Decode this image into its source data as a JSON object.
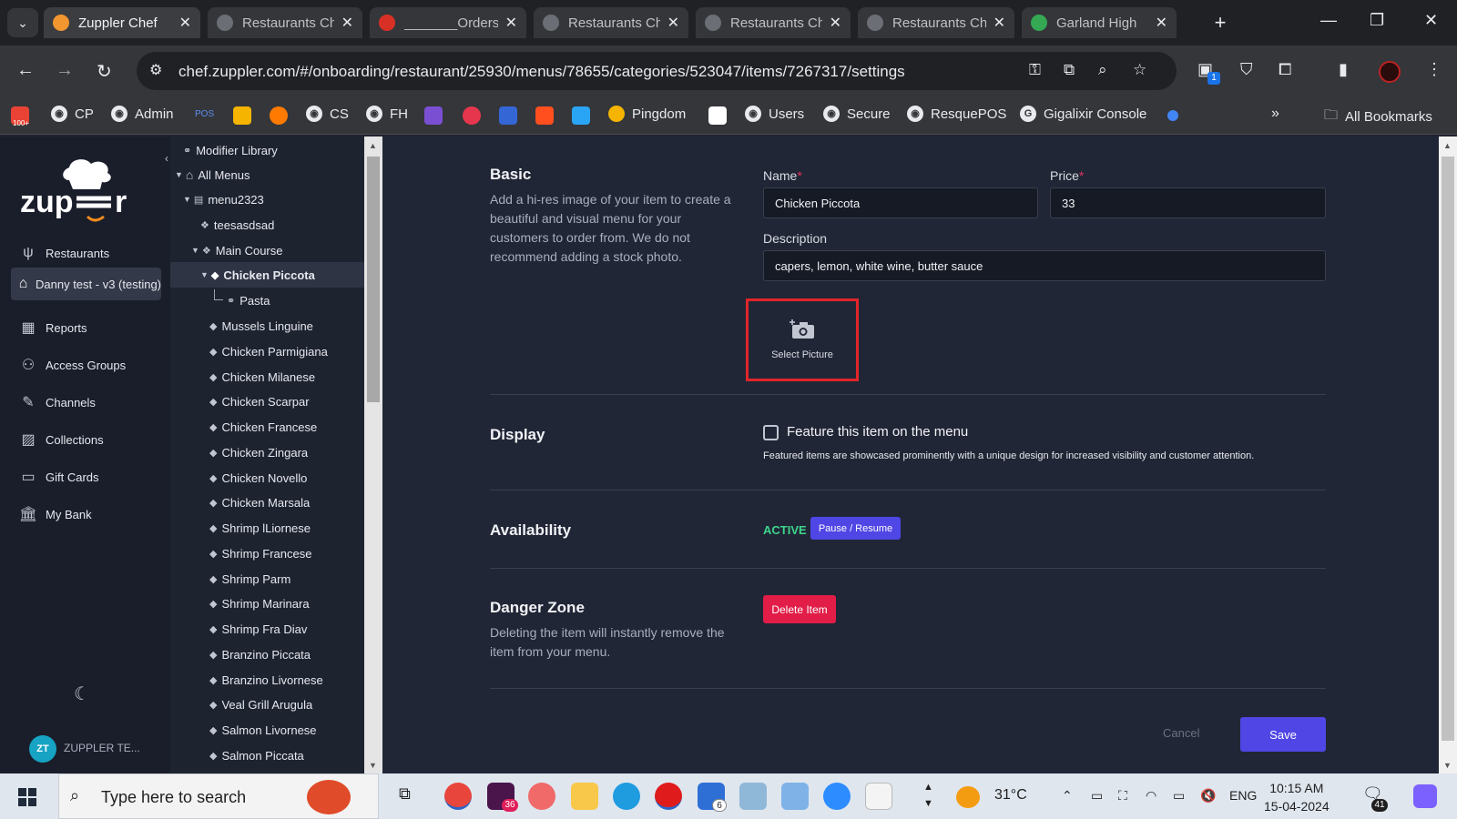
{
  "browser": {
    "tabs": [
      {
        "title": "Zuppler Chef",
        "active": true
      },
      {
        "title": "Restaurants Chef",
        "active": false
      },
      {
        "title": "_______Orders",
        "active": false
      },
      {
        "title": "Restaurants Chef",
        "active": false
      },
      {
        "title": "Restaurants Chef",
        "active": false
      },
      {
        "title": "Restaurants Chef",
        "active": false
      },
      {
        "title": "Garland High",
        "active": false
      }
    ],
    "url": "chef.zuppler.com/#/onboarding/restaurant/25930/menus/78655/categories/523047/items/7267317/settings",
    "extension_badge": "1",
    "bookmarks": [
      "CP",
      "Admin",
      "POS",
      "CS",
      "FH",
      "Pingdom",
      "Users",
      "Secure",
      "ResquePOS",
      "Gigalixir Console"
    ],
    "gmail_badge": "100+",
    "all_bookmarks": "All Bookmarks"
  },
  "sidebar": {
    "brand": "zupper",
    "items": [
      {
        "label": "Restaurants",
        "icon": "utensils-icon"
      },
      {
        "label": "Danny test - v3 (testing)",
        "icon": "home-icon",
        "selected": true
      },
      {
        "label": "Reports",
        "icon": "chart-icon"
      },
      {
        "label": "Access Groups",
        "icon": "users-icon"
      },
      {
        "label": "Channels",
        "icon": "feather-icon"
      },
      {
        "label": "Collections",
        "icon": "images-icon"
      },
      {
        "label": "Gift Cards",
        "icon": "card-icon"
      },
      {
        "label": "My Bank",
        "icon": "bank-icon"
      }
    ],
    "user_initials": "ZT",
    "user_name": "ZUPPLER TE..."
  },
  "tree": {
    "items": [
      "Modifier Library",
      "All Menus",
      "menu2323",
      "teesasdsad",
      "Main Course",
      "Chicken Piccota",
      "Pasta",
      "Mussels Linguine",
      "Chicken Parmigiana",
      "Chicken Milanese",
      "Chicken Scarpar",
      "Chicken Francese",
      "Chicken Zingara",
      "Chicken Novello",
      "Chicken Marsala",
      "Shrimp lLiornese",
      "Shrimp Francese",
      "Shrimp Parm",
      "Shrimp Marinara",
      "Shrimp Fra Diav",
      "Branzino Piccata",
      "Branzino Livornese",
      "Veal Grill Arugula",
      "Salmon Livornese",
      "Salmon Piccata"
    ]
  },
  "form": {
    "basic": {
      "title": "Basic",
      "description": "Add a hi-res image of your item to create a beautiful and visual menu for your customers to order from. We do not recommend adding a stock photo.",
      "name_label": "Name",
      "name_value": "Chicken Piccota",
      "price_label": "Price",
      "price_value": "33",
      "required_mark": "*",
      "desc_label": "Description",
      "desc_value": "capers, lemon, white wine, butter sauce",
      "select_picture": "Select Picture"
    },
    "display": {
      "title": "Display",
      "feature_label": "Feature this item on the menu",
      "feature_checked": false,
      "feature_help": "Featured items are showcased prominently with a unique design for increased visibility and customer attention."
    },
    "availability": {
      "title": "Availability",
      "status": "ACTIVE",
      "pause_label": "Pause / Resume"
    },
    "danger": {
      "title": "Danger Zone",
      "description": "Deleting the item will instantly remove the item from your menu.",
      "delete_label": "Delete Item"
    },
    "cancel_label": "Cancel",
    "save_label": "Save"
  },
  "taskbar": {
    "search_placeholder": "Type here to search",
    "weather": "31°C",
    "lang": "ENG",
    "time": "10:15 AM",
    "date": "15-04-2024",
    "notif_count": "41",
    "slack_badge": "36",
    "todo_badge": "6"
  }
}
